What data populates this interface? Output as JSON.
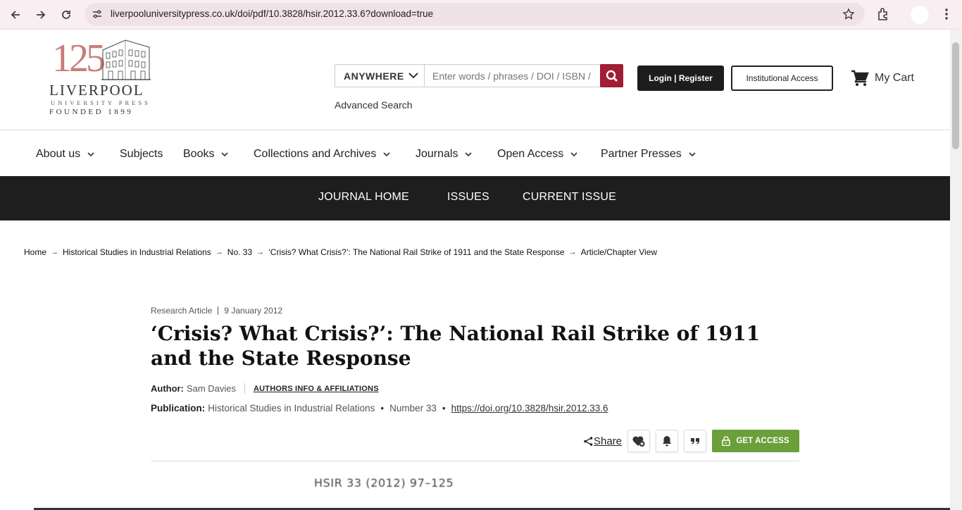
{
  "browser": {
    "url": "liverpooluniversitypress.co.uk/doi/pdf/10.3828/hsir.2012.33.6?download=true"
  },
  "logo": {
    "number": "125",
    "name": "LIVERPOOL",
    "subline": "UNIVERSITY PRESS",
    "founded": "FOUNDED 1899"
  },
  "search": {
    "scope": "ANYWHERE",
    "placeholder": "Enter words / phrases / DOI / ISBN /",
    "advanced": "Advanced Search"
  },
  "account": {
    "login": "Login | Register",
    "institutional": "Institutional Access",
    "cart": "My Cart"
  },
  "main_nav": {
    "items": [
      {
        "label": "About us"
      },
      {
        "label": "Subjects"
      },
      {
        "label": "Books"
      },
      {
        "label": "Collections and Archives"
      },
      {
        "label": "Journals"
      },
      {
        "label": "Open Access"
      },
      {
        "label": "Partner Presses"
      }
    ]
  },
  "journal_nav": {
    "items": [
      {
        "label": "JOURNAL HOME"
      },
      {
        "label": "ISSUES"
      },
      {
        "label": "CURRENT ISSUE"
      }
    ]
  },
  "breadcrumb": {
    "items": [
      {
        "label": "Home"
      },
      {
        "label": "Historical Studies in Industrial Relations"
      },
      {
        "label": "No. 33"
      },
      {
        "label": "‘Crisis? What Crisis?’: The National Rail Strike of 1911 and the State Response"
      },
      {
        "label": "Article/Chapter View"
      }
    ],
    "separator": "→"
  },
  "article": {
    "type": "Research Article",
    "date": "9 January 2012",
    "title": "‘Crisis? What Crisis?’: The National Rail Strike of 1911 and the State Response",
    "author_label": "Author:",
    "author": "Sam Davies",
    "affiliations_link": "AUTHORS INFO & AFFILIATIONS",
    "publication_label": "Publication:",
    "journal": "Historical Studies in Industrial Relations",
    "number": "Number 33",
    "doi": "https://doi.org/10.3828/hsir.2012.33.6",
    "pub_separator": "•"
  },
  "actions": {
    "share": "Share",
    "get_access": "GET ACCESS"
  },
  "pdf_preview": {
    "first_line": "HSIR 33 (2012) 97–125"
  },
  "colors": {
    "brand_red": "#a11d33",
    "access_green": "#6a9f3a",
    "nav_dark": "#1e1e1e",
    "logo_pink": "#c97d78"
  }
}
